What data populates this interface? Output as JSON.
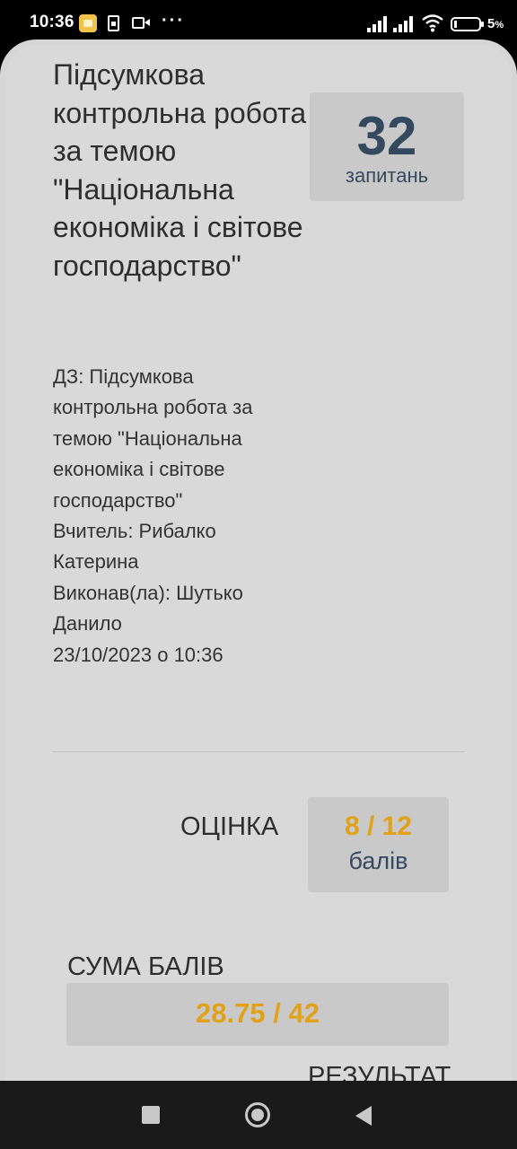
{
  "status_bar": {
    "time": "10:36",
    "more": "···",
    "battery_percent": "5",
    "battery_unit": "%"
  },
  "quiz": {
    "title": "Підсумкова контрольна робота за темою \"Національна економіка і світове господарство\"",
    "questions_count": "32",
    "questions_label": "запитань",
    "details": [
      "ДЗ: Підсумкова контрольна робота за темою \"Національна економіка і світове господарство\"",
      "Вчитель: Рибалко Катерина",
      "Виконав(ла): Шутько Данило",
      "23/10/2023 о 10:36"
    ]
  },
  "grade": {
    "label": "ОЦІНКА",
    "value": "8 / 12",
    "unit": "балів"
  },
  "sum": {
    "label": "СУМА БАЛІВ",
    "value": "28.75 / 42"
  },
  "result": {
    "label": "РЕЗУЛЬТАТ"
  },
  "colors": {
    "accent": "#e1a21a",
    "text_dark": "#34495e",
    "card_bg": "#d9d9d9",
    "box_bg": "#c9c9c9"
  },
  "icons": {
    "notification_app": "notification-app-icon",
    "sim": "sim-card-icon",
    "video": "video-camera-icon",
    "signal": "signal-icon",
    "wifi": "wifi-icon",
    "battery": "battery-icon",
    "nav_recents": "recents-square-icon",
    "nav_home": "home-circle-icon",
    "nav_back": "back-triangle-icon"
  }
}
